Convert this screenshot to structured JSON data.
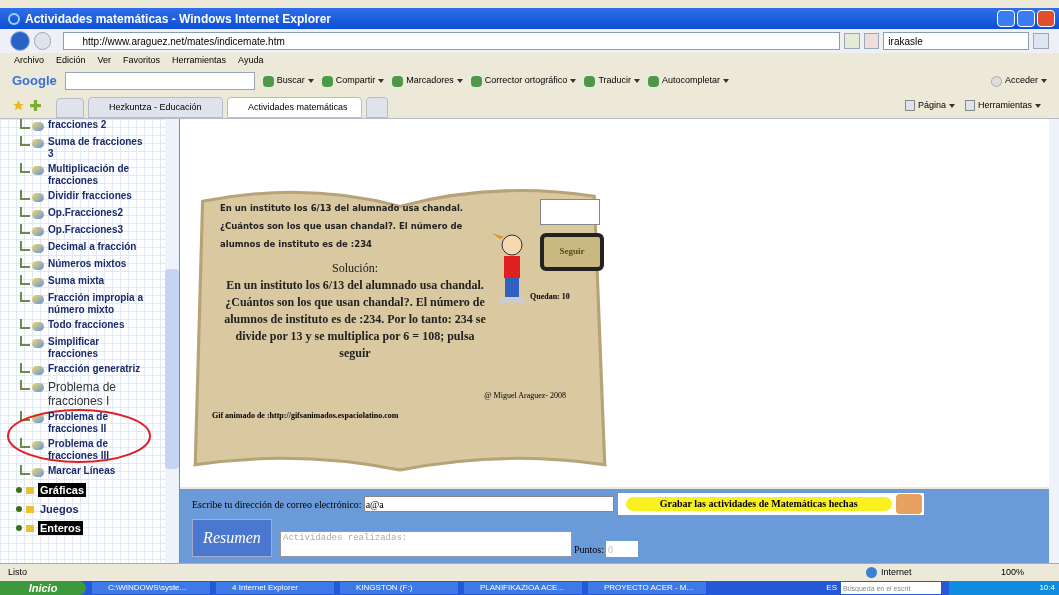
{
  "window": {
    "title": "Actividades matemáticas - Windows Internet Explorer"
  },
  "address": {
    "url": "http://www.araguez.net/mates/indicemate.htm",
    "search": "irakasle"
  },
  "menu": [
    "Archivo",
    "Edición",
    "Ver",
    "Favoritos",
    "Herramientas",
    "Ayuda"
  ],
  "google_toolbar": {
    "brand": "Google",
    "buttons": [
      "Buscar",
      "Compartir",
      "Marcadores",
      "Corrector ortográfico",
      "Traducir",
      "Autocompletar"
    ],
    "right_button": "Acceder"
  },
  "tabs": [
    {
      "label": "Hezkuntza - Educación",
      "selected": false
    },
    {
      "label": "Actividades matemáticas",
      "selected": true
    }
  ],
  "command_bar": [
    "Página",
    "Herramientas"
  ],
  "sidebar": {
    "items": [
      {
        "kind": "page",
        "label": "fracciones 2"
      },
      {
        "kind": "page",
        "label": "Suma de fracciones 3"
      },
      {
        "kind": "page",
        "label": "Multiplicación de fracciones"
      },
      {
        "kind": "page",
        "label": "Dividir fracciones"
      },
      {
        "kind": "page",
        "label": "Op.Fracciones2"
      },
      {
        "kind": "page",
        "label": "Op.Fracciones3"
      },
      {
        "kind": "page",
        "label": "Decimal a fracción"
      },
      {
        "kind": "page",
        "label": "Números mixtos"
      },
      {
        "kind": "page",
        "label": "Suma mixta"
      },
      {
        "kind": "page",
        "label": "Fracción impropia a número mixto"
      },
      {
        "kind": "page",
        "label": "Todo fracciones"
      },
      {
        "kind": "page",
        "label": "Simplificar fracciones"
      },
      {
        "kind": "page",
        "label": "Fracción generatriz"
      },
      {
        "kind": "large_page",
        "label": "Problema de fracciones I"
      },
      {
        "kind": "page",
        "label": "Problema de fracciones II"
      },
      {
        "kind": "page",
        "label": "Problema de fracciones III"
      },
      {
        "kind": "page",
        "label": "Marcar Líneas"
      },
      {
        "kind": "folder",
        "label": "Gráficas",
        "highlighted": true
      },
      {
        "kind": "folder",
        "label": "Juegos",
        "highlighted": false
      },
      {
        "kind": "folder",
        "label": "Enteros",
        "highlighted": true
      }
    ]
  },
  "activity": {
    "question": "En un instituto los 6/13 del alumnado usa chandal. ¿Cuántos son los que usan chandal?. El número de alumnos de instituto es de :234",
    "solution_title": "Solución:",
    "solution": "En un instituto los 6/13 del alumnado usa chandal. ¿Cuántos son los que usan chandal?. El número de alumnos de instituto es de :234. Por lo tanto: 234 se divide por 13 y se multiplica por 6 = 108; pulsa seguir",
    "button": "Seguir",
    "remaining": "Quedan: 10",
    "copyright": "@ Miguel Araguez- 2008",
    "credit": "Gif animado de :http://gifsanimados.espaciolatino.com"
  },
  "form": {
    "email_label": "Escribe tu dirección de correo electrónico:",
    "email_value": "a@a",
    "save_button": "Grabar las actividades de Matemáticas hechas",
    "summary_button": "Resumen",
    "activities_placeholder": "Actividades realizadas:",
    "points_label": "Puntos:",
    "points_placeholder": "0"
  },
  "status_bar": {
    "text": "Listo",
    "zone": "Internet",
    "zoom": "100%"
  },
  "taskbar": {
    "start": "Inicio",
    "items": [
      "C:\\WINDOWS\\syste...",
      "4 Internet Explorer",
      "KINGSTON (F:)",
      "PLANIFIKAZIOA ACE...",
      "PROYECTO ACER - M..."
    ],
    "language": "ES",
    "search_placeholder": "Búsqueda en el escrit",
    "clock": "10:4"
  }
}
